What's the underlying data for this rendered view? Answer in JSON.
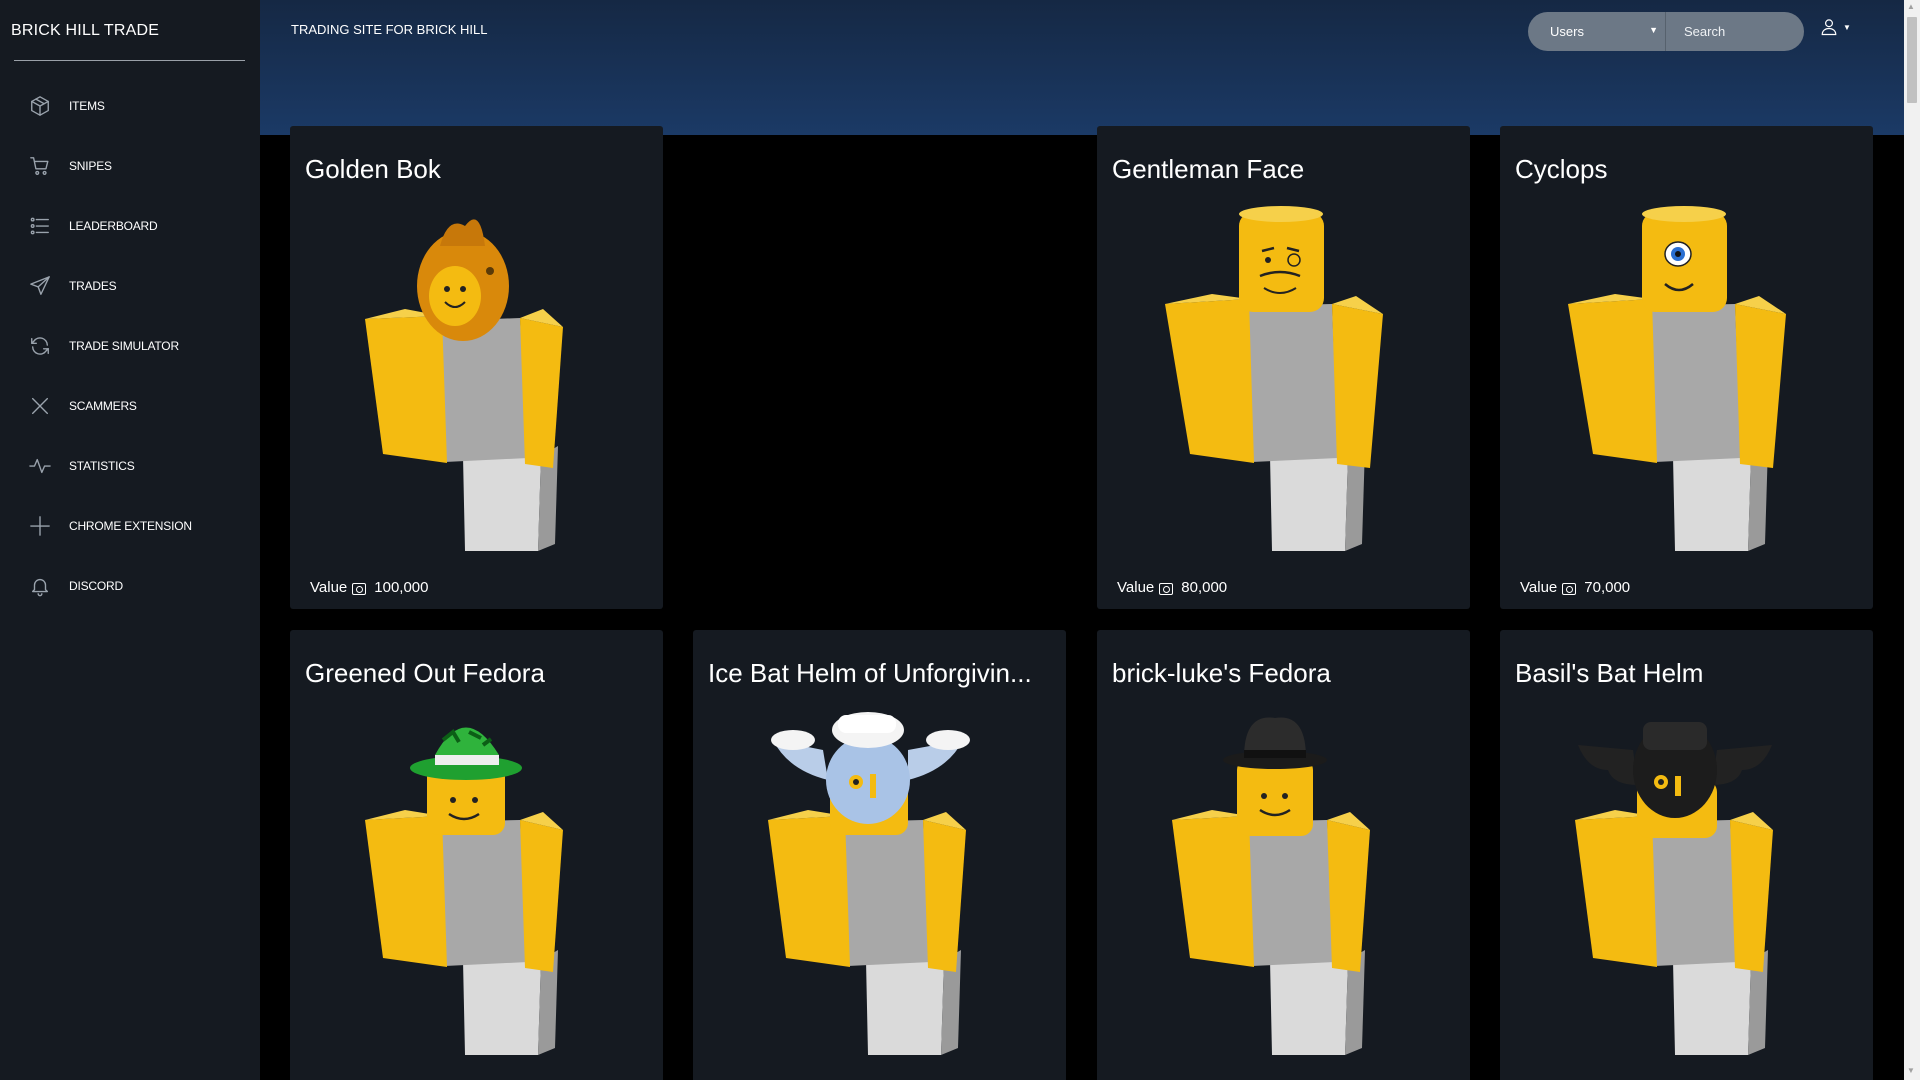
{
  "sidebar": {
    "brand": "BRICK HILL TRADE",
    "items": [
      {
        "label": "ITEMS",
        "icon": "box-icon"
      },
      {
        "label": "SNIPES",
        "icon": "cart-icon"
      },
      {
        "label": "LEADERBOARD",
        "icon": "list-icon"
      },
      {
        "label": "TRADES",
        "icon": "send-icon"
      },
      {
        "label": "TRADE SIMULATOR",
        "icon": "refresh-icon"
      },
      {
        "label": "SCAMMERS",
        "icon": "x-icon"
      },
      {
        "label": "STATISTICS",
        "icon": "activity-icon"
      },
      {
        "label": "CHROME EXTENSION",
        "icon": "plus-icon"
      },
      {
        "label": "DISCORD",
        "icon": "bell-icon"
      }
    ]
  },
  "header": {
    "subtitle": "TRADING SITE FOR BRICK HILL",
    "search_type": "Users",
    "search_placeholder": "Search"
  },
  "cards": [
    {
      "title": "Golden Bok",
      "value_label": "Value",
      "value": "100,000",
      "hat": "golden-bok"
    },
    {
      "title": "Gentleman Face",
      "value_label": "Value",
      "value": "80,000",
      "hat": "gentleman-face"
    },
    {
      "title": "Cyclops",
      "value_label": "Value",
      "value": "70,000",
      "hat": "cyclops"
    },
    {
      "title": "Greened Out Fedora",
      "hat": "green-fedora"
    },
    {
      "title": "Ice Bat Helm of Unforgivin...",
      "hat": "ice-bat-helm"
    },
    {
      "title": "brick-luke's Fedora",
      "hat": "black-fedora"
    },
    {
      "title": "Basil's Bat Helm",
      "hat": "black-bat-helm"
    }
  ],
  "colors": {
    "sidebar_bg": "#151a21",
    "header_top": "#152844",
    "header_bottom": "#1b3a66",
    "card_bg": "#151a21",
    "avatar_yellow": "#f4bb11",
    "avatar_torso": "#a8a8a8",
    "avatar_legs": "#dadada"
  }
}
